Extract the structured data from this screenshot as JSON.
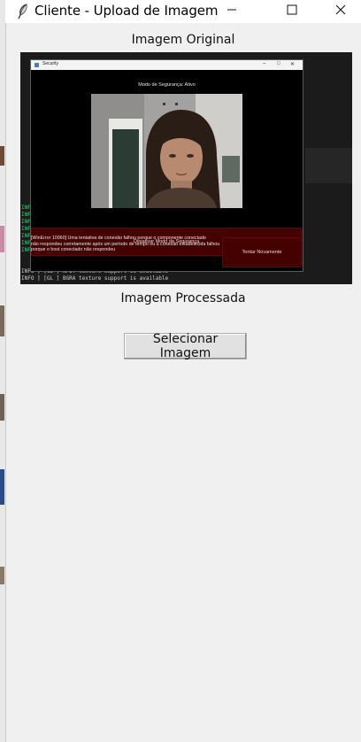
{
  "window": {
    "title": "Cliente - Upload de Imagem",
    "app_icon": "feather-icon",
    "controls": {
      "minimize": "minimize-icon",
      "maximize": "maximize-icon",
      "close": "close-icon"
    }
  },
  "original": {
    "label": "Imagem Original",
    "screenshot": {
      "security_window": {
        "title": "Security",
        "status": "Modo de Segurança: Ativo",
        "disable_button": "Desativar Modo de Segurança",
        "error_lines": [
          "[WinError 10060] Uma tentativa de conexão falhou porque o componente conectado",
          "não respondeu corretamente após um período de tempo ou a conexão estabelecida falhou",
          "porque o host conectado não respondeu"
        ],
        "retry_button": "Tentar Novamente"
      },
      "terminal": {
        "tags": [
          "INFO",
          "INFO",
          "INFO",
          "INFO",
          "INFO",
          "INFO",
          "INFO",
          "INFO",
          "INFO"
        ],
        "bottom_lines": [
          "INFO   ] [GL          ] NPOT texture support is available",
          "INFO   ] [GL          ] BGRA texture support is available"
        ]
      }
    }
  },
  "processed": {
    "label": "Imagem Processada"
  },
  "actions": {
    "select_image": "Selecionar Imagem"
  }
}
